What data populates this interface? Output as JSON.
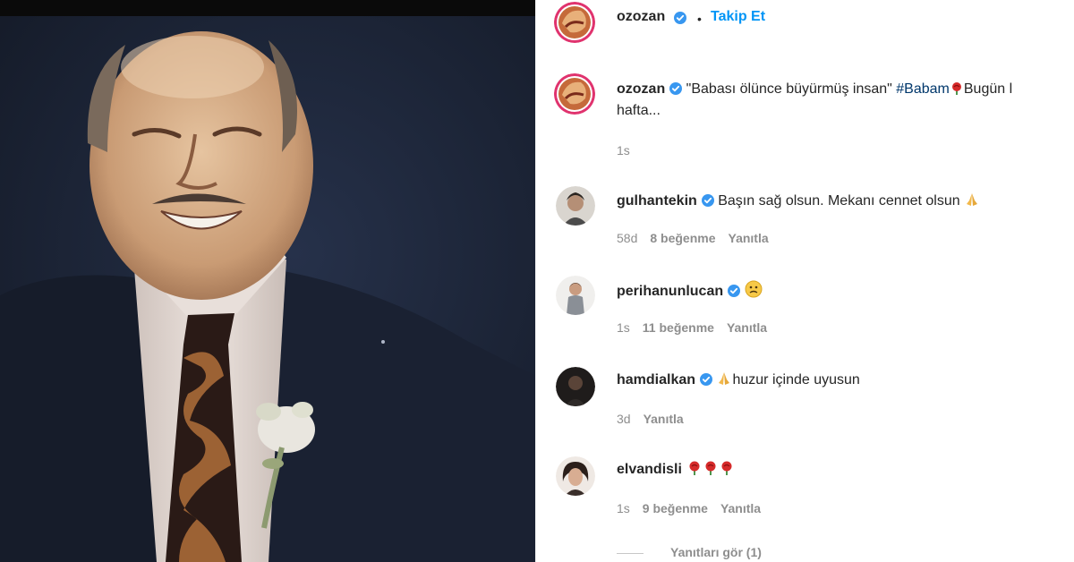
{
  "post": {
    "author": "ozozan",
    "follow_label": "Takip Et",
    "dot": "•",
    "caption_text": "\"Babası ölünce büyürmüş insan\" ",
    "caption_hashtag": "#Babam",
    "caption_rest": "Bugün l",
    "caption_more": "hafta...",
    "caption_time": "1s"
  },
  "comments": [
    {
      "user": "gulhantekin",
      "text": "Başın sağ olsun. Mekanı cennet olsun",
      "emoji": "praying-hands",
      "time": "58d",
      "likes": "8 beğenme",
      "reply": "Yanıtla"
    },
    {
      "user": "perihanunlucan",
      "text": "",
      "emoji": "sad-face",
      "time": "1s",
      "likes": "11 beğenme",
      "reply": "Yanıtla"
    },
    {
      "user": "hamdialkan",
      "text": "huzur içinde uyusun",
      "emoji": "praying-hands",
      "time": "3d",
      "likes": "",
      "reply": "Yanıtla"
    },
    {
      "user": "elvandisli",
      "text": "",
      "emoji": "three-roses",
      "time": "1s",
      "likes": "9 beğenme",
      "reply": "Yanıtla"
    }
  ],
  "view_replies": "Yanıtları gör (1)",
  "colors": {
    "follow_blue": "#0095f6",
    "verified_blue": "#3897f0",
    "muted_gray": "#8e8e8e",
    "photo_background": "#1c2536"
  }
}
